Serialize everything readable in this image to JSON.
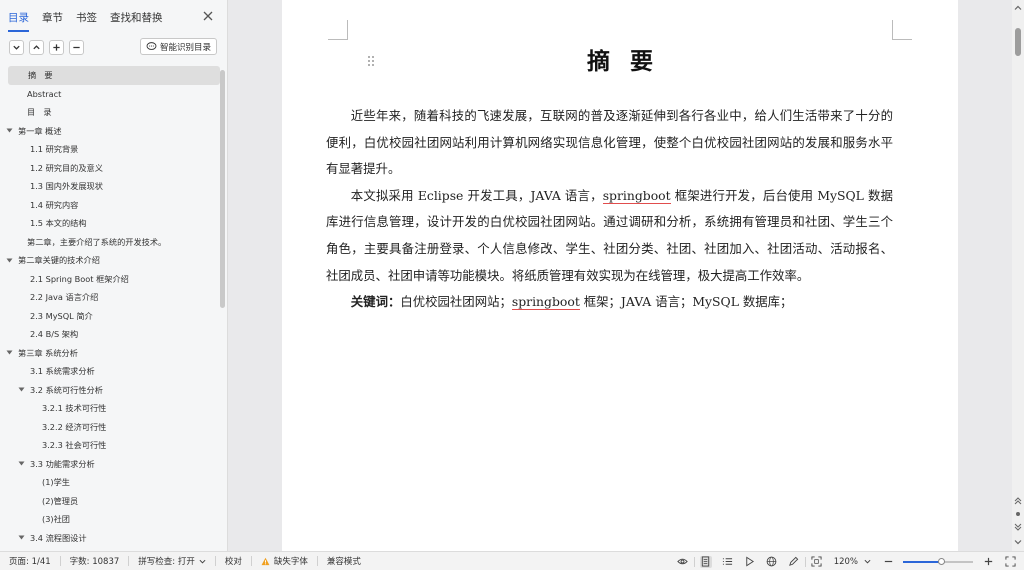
{
  "sidebar": {
    "tabs": [
      "目录",
      "章节",
      "书签",
      "查找和替换"
    ],
    "smart_toc_label": "智能识别目录",
    "toc": [
      {
        "label": "摘　要",
        "level": 0,
        "arrow": "",
        "selected": true
      },
      {
        "label": "Abstract",
        "level": 0,
        "arrow": ""
      },
      {
        "label": "目　录",
        "level": 0,
        "arrow": ""
      },
      {
        "label": "第一章  概述",
        "level": 0,
        "arrow": "down"
      },
      {
        "label": "1.1  研究背景",
        "level": 1,
        "arrow": ""
      },
      {
        "label": "1.2 研究目的及意义",
        "level": 1,
        "arrow": ""
      },
      {
        "label": "1.3 国内外发展现状",
        "level": 1,
        "arrow": ""
      },
      {
        "label": "1.4  研究内容",
        "level": 1,
        "arrow": ""
      },
      {
        "label": "1.5 本文的结构",
        "level": 1,
        "arrow": ""
      },
      {
        "label": "第二章，主要介绍了系统的开发技术。",
        "level": 0,
        "arrow": ""
      },
      {
        "label": "第二章关键的技术介绍",
        "level": 0,
        "arrow": "down"
      },
      {
        "label": "2.1 Spring Boot 框架介绍",
        "level": 1,
        "arrow": ""
      },
      {
        "label": "2.2 Java 语言介绍",
        "level": 1,
        "arrow": ""
      },
      {
        "label": "2.3 MySQL 简介",
        "level": 1,
        "arrow": ""
      },
      {
        "label": "2.4 B/S 架构",
        "level": 1,
        "arrow": ""
      },
      {
        "label": "第三章  系统分析",
        "level": 0,
        "arrow": "down"
      },
      {
        "label": "3.1 系统需求分析",
        "level": 1,
        "arrow": ""
      },
      {
        "label": "3.2 系统可行性分析",
        "level": 1,
        "arrow": "down"
      },
      {
        "label": "3.2.1 技术可行性",
        "level": 2,
        "arrow": ""
      },
      {
        "label": "3.2.2  经济可行性",
        "level": 2,
        "arrow": ""
      },
      {
        "label": "3.2.3 社会可行性",
        "level": 2,
        "arrow": ""
      },
      {
        "label": "3.3  功能需求分析",
        "level": 1,
        "arrow": "down"
      },
      {
        "label": "(1)学生",
        "level": 2,
        "arrow": ""
      },
      {
        "label": "(2)管理员",
        "level": 2,
        "arrow": ""
      },
      {
        "label": "(3)社团",
        "level": 2,
        "arrow": ""
      },
      {
        "label": "3.4 流程图设计",
        "level": 1,
        "arrow": "down"
      }
    ]
  },
  "document": {
    "title": "摘要",
    "para1": "近些年来，随着科技的飞速发展，互联网的普及逐渐延伸到各行各业中，给人们生活带来了十分的便利，白优校园社团网站利用计算机网络实现信息化管理，使整个白优校园社团网站的发展和服务水平有显著提升。",
    "para2_a": "本文拟采用 Eclipse 开发工具，JAVA 语言，",
    "para2_spell": "springboot",
    "para2_b": " 框架进行开发，后台使用 MySQL 数据库进行信息管理，设计开发的白优校园社团网站。通过调研和分析，系统拥有管理员和社团、学生三个角色，主要具备注册登录、个人信息修改、学生、社团分类、社团、社团加入、社团活动、活动报名、社团成员、社团申请等功能模块。将纸质管理有效实现为在线管理，极大提高工作效率。",
    "keywords_label": "关键词：",
    "keywords_a": "白优校园社团网站；",
    "keywords_spell": "springboot",
    "keywords_b": " 框架；JAVA 语言；MySQL 数据库；"
  },
  "status": {
    "page": "页面: 1/41",
    "words": "字数: 10837",
    "spell_check": "拼写检查: 打开",
    "proofread": "校对",
    "missing_font": "缺失字体",
    "compat_mode": "兼容模式",
    "zoom": "120%",
    "zoom_level_fraction": 0.55
  },
  "colors": {
    "accent": "#2b66d8",
    "spell_underline": "#e14d4d",
    "warning": "#f0a020"
  }
}
